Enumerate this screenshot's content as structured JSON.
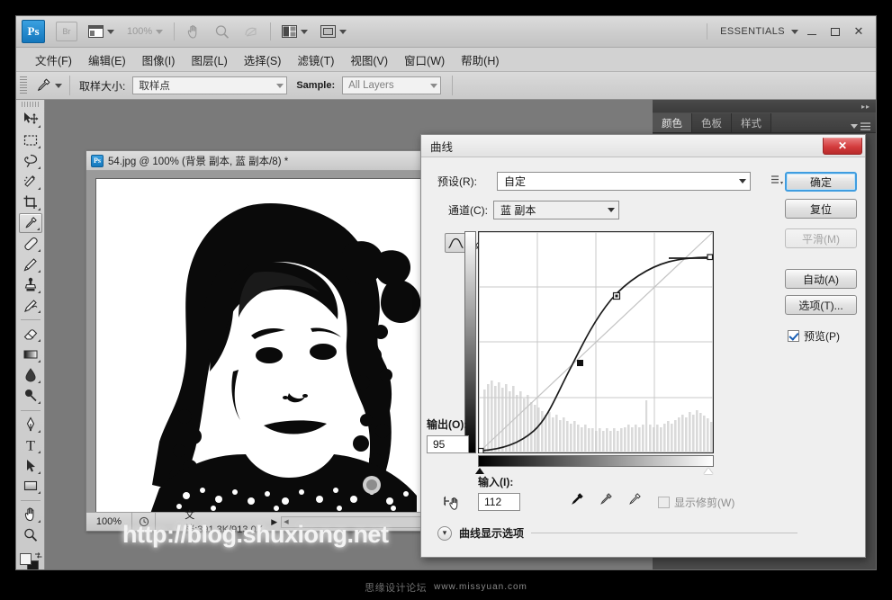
{
  "app": {
    "logo_text": "Ps",
    "bridge_label": "Br",
    "zoom_level": "100%",
    "workspace_name": "ESSENTIALS",
    "window_minimize": "minimize-icon",
    "window_maximize": "maximize-icon",
    "window_close": "✕"
  },
  "menu": {
    "items": [
      {
        "label": "文件(F)"
      },
      {
        "label": "编辑(E)"
      },
      {
        "label": "图像(I)"
      },
      {
        "label": "图层(L)"
      },
      {
        "label": "选择(S)"
      },
      {
        "label": "滤镜(T)"
      },
      {
        "label": "视图(V)"
      },
      {
        "label": "窗口(W)"
      },
      {
        "label": "帮助(H)"
      }
    ]
  },
  "options_bar": {
    "tool_icon": "eyedropper-icon",
    "sample_size_label": "取样大小:",
    "sample_size_value": "取样点",
    "sample_label": "Sample:",
    "sample_value": "All Layers"
  },
  "toolbox": {
    "tools": [
      {
        "name": "move-tool",
        "icon": "move-icon",
        "active": false
      },
      {
        "name": "marquee-tool",
        "icon": "rectangular-marquee-icon",
        "active": false
      },
      {
        "name": "lasso-tool",
        "icon": "lasso-icon",
        "active": false
      },
      {
        "name": "quick-selection-tool",
        "icon": "quick-selection-icon",
        "active": false
      },
      {
        "name": "crop-tool",
        "icon": "crop-icon",
        "active": false
      },
      {
        "name": "eyedropper-tool",
        "icon": "eyedropper-icon",
        "active": true
      },
      {
        "name": "healing-brush-tool",
        "icon": "healing-brush-icon",
        "active": false
      },
      {
        "name": "brush-tool",
        "icon": "brush-icon",
        "active": false
      },
      {
        "name": "clone-stamp-tool",
        "icon": "clone-stamp-icon",
        "active": false
      },
      {
        "name": "history-brush-tool",
        "icon": "history-brush-icon",
        "active": false
      },
      {
        "name": "eraser-tool",
        "icon": "eraser-icon",
        "active": false
      },
      {
        "name": "gradient-tool",
        "icon": "gradient-icon",
        "active": false
      },
      {
        "name": "blur-tool",
        "icon": "blur-drop-icon",
        "active": false
      },
      {
        "name": "dodge-tool",
        "icon": "dodge-icon",
        "active": false
      },
      {
        "name": "pen-tool",
        "icon": "pen-icon",
        "active": false
      },
      {
        "name": "type-tool",
        "icon": "type-t-icon",
        "active": false
      },
      {
        "name": "path-selection-tool",
        "icon": "path-arrow-icon",
        "active": false
      },
      {
        "name": "shape-tool",
        "icon": "rectangle-shape-icon",
        "active": false
      },
      {
        "name": "hand-tool",
        "icon": "hand-icon",
        "active": false
      },
      {
        "name": "zoom-tool",
        "icon": "magnifier-icon",
        "active": false
      }
    ],
    "foreground_color": "#f4f4f4",
    "background_color": "#1a1a1a"
  },
  "document": {
    "title": "54.jpg @ 100% (背景 副本, 蓝 副本/8) *",
    "status_zoom": "100%",
    "status_doc": "文档:391.3K/913.0K",
    "canvas_watermark": "http://blog.shuxiong.net"
  },
  "dock": {
    "tabs": [
      {
        "label": "颜色",
        "active": true
      },
      {
        "label": "色板",
        "active": false
      },
      {
        "label": "样式",
        "active": false
      }
    ]
  },
  "dialog": {
    "title": "曲线",
    "close_label": "✕",
    "preset_label": "预设(R):",
    "preset_value": "自定",
    "channel_label": "通道(C):",
    "channel_value": "蓝 副本",
    "output_label": "输出(O):",
    "output_value": "95",
    "input_label": "输入(I):",
    "input_value": "112",
    "show_clipping_label": "显示修剪(W)",
    "show_clipping_checked": false,
    "curve_display_options_label": "曲线显示选项",
    "buttons": [
      {
        "label": "确定",
        "name": "ok-button",
        "state": "primary"
      },
      {
        "label": "复位",
        "name": "reset-button",
        "state": "normal"
      },
      {
        "label": "平滑(M)",
        "name": "smooth-button",
        "state": "disabled"
      },
      {
        "label": "自动(A)",
        "name": "auto-button",
        "state": "normal"
      },
      {
        "label": "选项(T)...",
        "name": "options-button",
        "state": "normal"
      }
    ],
    "preview_label": "预览(P)",
    "preview_checked": true,
    "curve_edit_mode_icon": "curve-edit-icon",
    "pencil_draw_mode_icon": "pencil-draw-icon",
    "eyedroppers": [
      {
        "name": "set-black-point-eyedropper",
        "icon": "eyedropper-black-icon"
      },
      {
        "name": "set-gray-point-eyedropper",
        "icon": "eyedropper-gray-icon"
      },
      {
        "name": "set-white-point-eyedropper",
        "icon": "eyedropper-white-icon"
      }
    ]
  },
  "chart_data": {
    "type": "line",
    "title": "曲线",
    "xlabel": "输入(I)",
    "ylabel": "输出(O)",
    "xlim": [
      0,
      255
    ],
    "ylim": [
      0,
      255
    ],
    "grid": true,
    "grid_divisions": 4,
    "series": [
      {
        "name": "identity-baseline",
        "points": [
          [
            0,
            0
          ],
          [
            255,
            255
          ]
        ]
      },
      {
        "name": "blue-copy-channel-curve",
        "control_points": [
          [
            0,
            0
          ],
          [
            112,
            95
          ],
          [
            160,
            190
          ],
          [
            232,
            255
          ]
        ],
        "points": [
          [
            0,
            0
          ],
          [
            20,
            3
          ],
          [
            40,
            9
          ],
          [
            60,
            19
          ],
          [
            80,
            35
          ],
          [
            96,
            55
          ],
          [
            112,
            95
          ],
          [
            128,
            140
          ],
          [
            140,
            165
          ],
          [
            160,
            190
          ],
          [
            180,
            222
          ],
          [
            200,
            243
          ],
          [
            220,
            252
          ],
          [
            232,
            255
          ],
          [
            255,
            255
          ]
        ]
      }
    ],
    "selected_point": {
      "input": 112,
      "output": 95
    },
    "histogram": {
      "bins": 64,
      "values": [
        18,
        22,
        26,
        21,
        24,
        20,
        23,
        19,
        22,
        17,
        20,
        16,
        18,
        15,
        14,
        13,
        12,
        11,
        12,
        10,
        11,
        9,
        10,
        9,
        8,
        9,
        8,
        7,
        8,
        7,
        7,
        6,
        7,
        6,
        7,
        6,
        7,
        6,
        7,
        7,
        8,
        7,
        8,
        7,
        8,
        22,
        8,
        7,
        8,
        7,
        8,
        9,
        8,
        9,
        10,
        11,
        10,
        12,
        11,
        13,
        12,
        11,
        10,
        9
      ]
    }
  },
  "footer": {
    "site_cn": "思缘设计论坛",
    "site_url": "www.missyuan.com"
  }
}
